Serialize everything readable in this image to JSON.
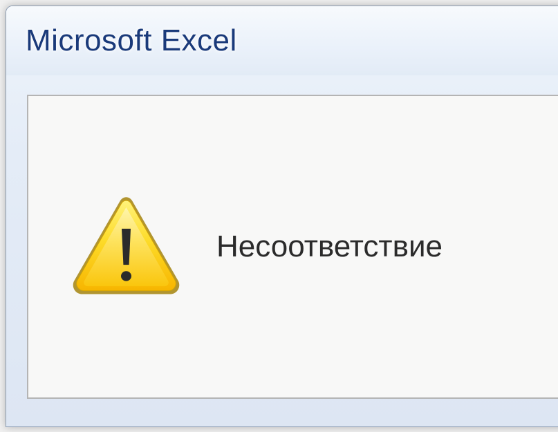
{
  "dialog": {
    "title": "Microsoft Excel",
    "message": "Несоответствие",
    "icon": "warning"
  }
}
